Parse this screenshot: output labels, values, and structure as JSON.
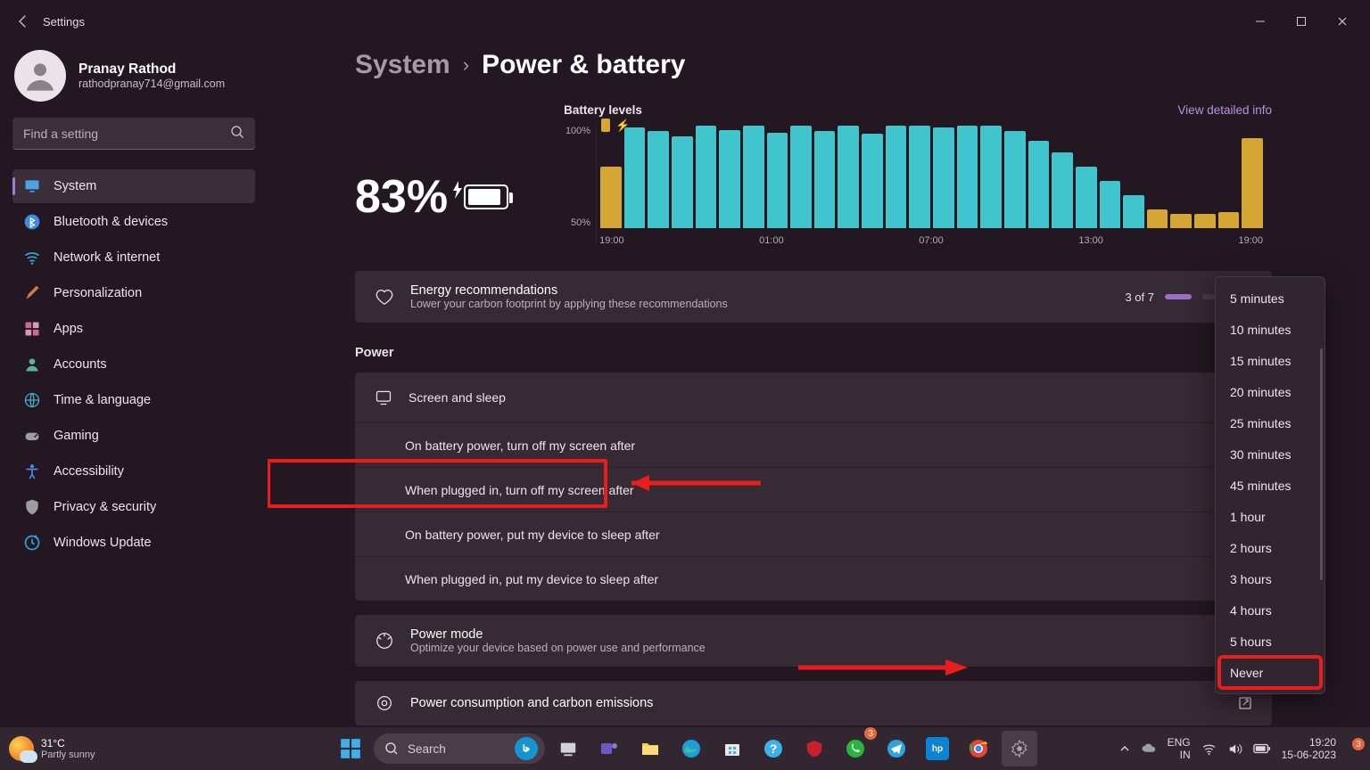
{
  "titlebar": {
    "title": "Settings"
  },
  "profile": {
    "name": "Pranay Rathod",
    "email": "rathodpranay714@gmail.com"
  },
  "search": {
    "placeholder": "Find a setting"
  },
  "nav": [
    {
      "label": "System",
      "icon": "display",
      "active": true,
      "color": "#4aa3e0"
    },
    {
      "label": "Bluetooth & devices",
      "icon": "bluetooth",
      "color": "#3a8de0"
    },
    {
      "label": "Network & internet",
      "icon": "wifi",
      "color": "#3aa0d8"
    },
    {
      "label": "Personalization",
      "icon": "brush",
      "color": "#d07a4a"
    },
    {
      "label": "Apps",
      "icon": "apps",
      "color": "#c86a9a"
    },
    {
      "label": "Accounts",
      "icon": "person",
      "color": "#5ab0a0"
    },
    {
      "label": "Time & language",
      "icon": "globe",
      "color": "#4aa8c8"
    },
    {
      "label": "Gaming",
      "icon": "gamepad",
      "color": "#9a9e9e"
    },
    {
      "label": "Accessibility",
      "icon": "access",
      "color": "#4a8ae0"
    },
    {
      "label": "Privacy & security",
      "icon": "shield",
      "color": "#9a9e9e"
    },
    {
      "label": "Windows Update",
      "icon": "update",
      "color": "#2aa8e0"
    }
  ],
  "breadcrumb": {
    "parent": "System",
    "current": "Power & battery"
  },
  "battery": {
    "percent": "83%"
  },
  "chart_head": {
    "label": "Battery levels",
    "link": "View detailed info"
  },
  "chart_data": {
    "type": "bar",
    "ylim": [
      0,
      100
    ],
    "yticks": [
      "100%",
      "50%"
    ],
    "xticks": [
      "19:00",
      "01:00",
      "07:00",
      "13:00",
      "19:00"
    ],
    "bars": [
      {
        "h": 60,
        "c": "#d6a635"
      },
      {
        "h": 98,
        "c": "#41c5cc"
      },
      {
        "h": 95,
        "c": "#41c5cc"
      },
      {
        "h": 90,
        "c": "#41c5cc"
      },
      {
        "h": 100,
        "c": "#41c5cc"
      },
      {
        "h": 96,
        "c": "#41c5cc"
      },
      {
        "h": 100,
        "c": "#41c5cc"
      },
      {
        "h": 93,
        "c": "#41c5cc"
      },
      {
        "h": 100,
        "c": "#41c5cc"
      },
      {
        "h": 95,
        "c": "#41c5cc"
      },
      {
        "h": 100,
        "c": "#41c5cc"
      },
      {
        "h": 92,
        "c": "#41c5cc"
      },
      {
        "h": 100,
        "c": "#41c5cc"
      },
      {
        "h": 100,
        "c": "#41c5cc"
      },
      {
        "h": 98,
        "c": "#41c5cc"
      },
      {
        "h": 100,
        "c": "#41c5cc"
      },
      {
        "h": 100,
        "c": "#41c5cc"
      },
      {
        "h": 95,
        "c": "#41c5cc"
      },
      {
        "h": 85,
        "c": "#41c5cc"
      },
      {
        "h": 74,
        "c": "#41c5cc"
      },
      {
        "h": 60,
        "c": "#41c5cc"
      },
      {
        "h": 46,
        "c": "#41c5cc"
      },
      {
        "h": 32,
        "c": "#41c5cc"
      },
      {
        "h": 18,
        "c": "#d6a635"
      },
      {
        "h": 14,
        "c": "#d6a635"
      },
      {
        "h": 14,
        "c": "#d6a635"
      },
      {
        "h": 16,
        "c": "#d6a635"
      },
      {
        "h": 88,
        "c": "#d6a635"
      }
    ]
  },
  "energy": {
    "title": "Energy recommendations",
    "sub": "Lower your carbon footprint by applying these recommendations",
    "count": "3 of 7"
  },
  "power_section": "Power",
  "screen_sleep": "Screen and sleep",
  "rows": [
    "On battery power, turn off my screen after",
    "When plugged in, turn off my screen after",
    "On battery power, put my device to sleep after",
    "When plugged in, put my device to sleep after"
  ],
  "powermode": {
    "title": "Power mode",
    "sub": "Optimize your device based on power use and performance"
  },
  "carbon": {
    "title": "Power consumption and carbon emissions"
  },
  "dropdown": [
    "5 minutes",
    "10 minutes",
    "15 minutes",
    "20 minutes",
    "25 minutes",
    "30 minutes",
    "45 minutes",
    "1 hour",
    "2 hours",
    "3 hours",
    "4 hours",
    "5 hours",
    "Never"
  ],
  "taskbar": {
    "weather_temp": "31°C",
    "weather_desc": "Partly sunny",
    "search": "Search",
    "lang1": "ENG",
    "lang2": "IN",
    "time": "19:20",
    "date": "15-06-2023"
  }
}
